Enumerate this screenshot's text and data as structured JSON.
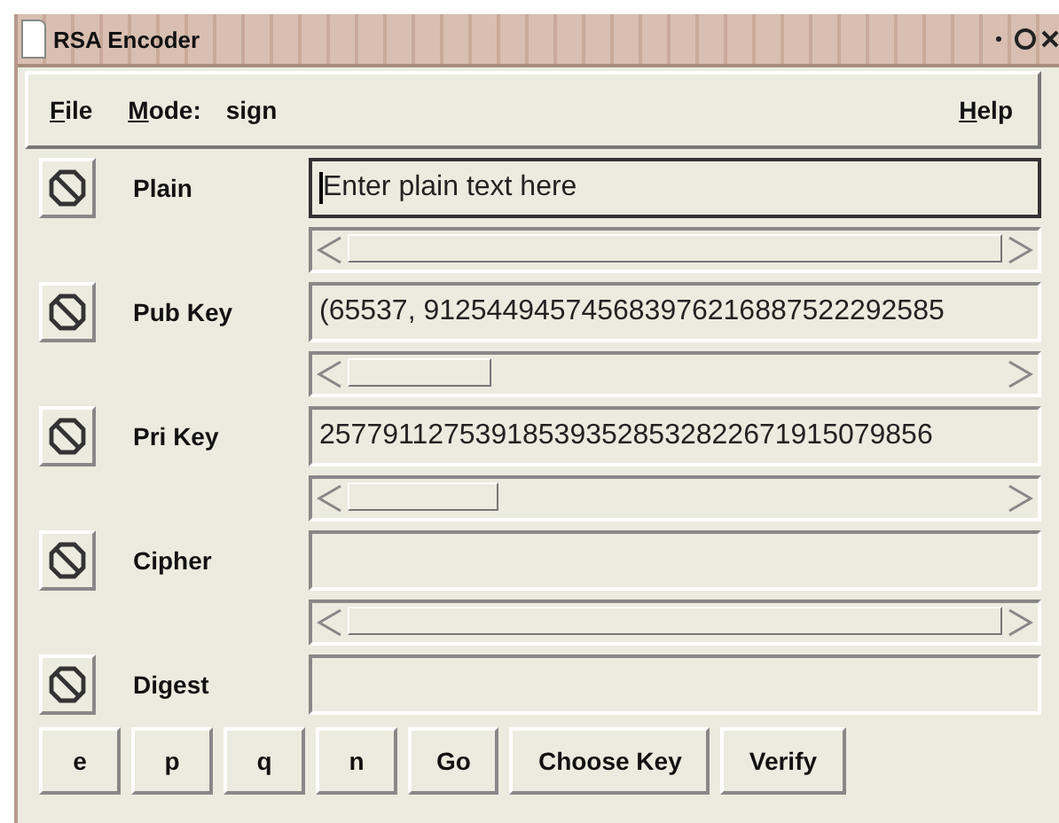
{
  "window": {
    "title": "RSA Encoder"
  },
  "menu": {
    "items": [
      {
        "label": "File",
        "mnemonic_underlined": true
      },
      {
        "label": "Mode:",
        "mnemonic_underlined": true
      }
    ],
    "mode_value": "sign",
    "help": {
      "label": "Help",
      "mnemonic_underlined": true
    }
  },
  "rows": [
    {
      "label": "Plain",
      "value": "Enter plain text here",
      "focused": true,
      "has_scrollbar": true
    },
    {
      "label": "Pub Key",
      "value": "(65537, 912544945745683976216887522292585",
      "focused": false,
      "has_scrollbar": true
    },
    {
      "label": "Pri Key",
      "value": "257791127539185393528532822671915079856",
      "focused": false,
      "has_scrollbar": true
    },
    {
      "label": "Cipher",
      "value": "",
      "focused": false,
      "has_scrollbar": true
    },
    {
      "label": "Digest",
      "value": "",
      "focused": false,
      "has_scrollbar": false
    }
  ],
  "buttons": [
    "e",
    "p",
    "q",
    "n",
    "Go",
    "Choose Key",
    "Verify"
  ]
}
